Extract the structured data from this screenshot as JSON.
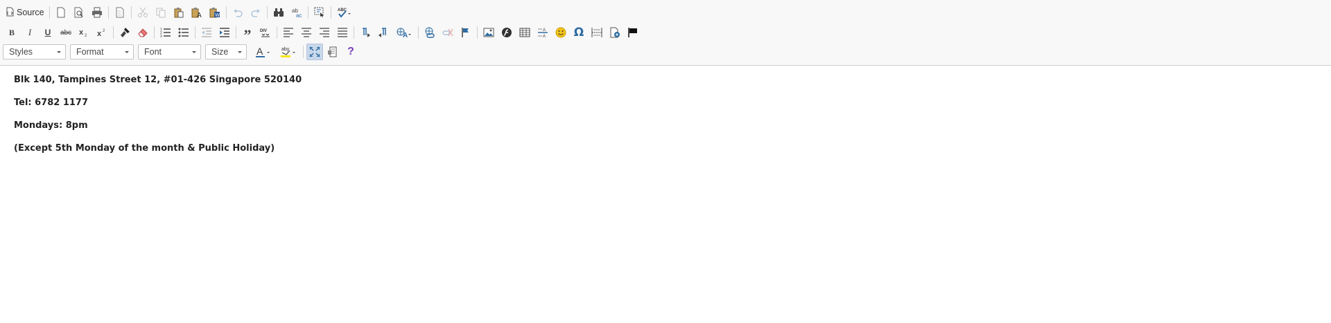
{
  "toolbar": {
    "source_label": "Source",
    "combos": {
      "styles": "Styles",
      "format": "Format",
      "font": "Font",
      "size": "Size"
    },
    "glyphs": {
      "bold": "B",
      "italic": "I",
      "underline": "U",
      "strike": "abc",
      "blockquote": "”",
      "special_char": "Ω",
      "help": "?"
    }
  },
  "content": {
    "lines": [
      "Blk 140, Tampines Street 12, #01-426 Singapore 520140",
      "Tel: 6782 1177",
      "Mondays: 8pm",
      "(Except 5th Monday of the month & Public Holiday)"
    ]
  },
  "colors": {
    "toolbar_bg": "#f8f8f8",
    "active_bg": "#c9d7ea",
    "icon": "#474747",
    "blue_icon": "#2f6ca3",
    "smiley": "#f5c518",
    "help": "#7d3fb8"
  }
}
